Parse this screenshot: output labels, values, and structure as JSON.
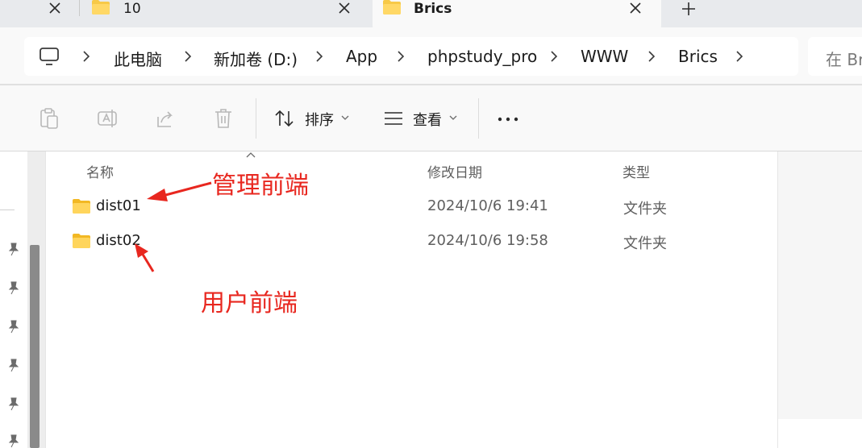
{
  "tabs": [
    {
      "title": "10",
      "icon": "folder-icon",
      "active": false
    },
    {
      "title": "Brics",
      "icon": "folder-icon",
      "active": true
    }
  ],
  "new_tab_icon": "plus-icon",
  "breadcrumb": [
    "此电脑",
    "新加卷 (D:)",
    "App",
    "phpstudy_pro",
    "WWW",
    "Brics"
  ],
  "search": {
    "placeholder": "在 Br"
  },
  "toolbar": {
    "icons": [
      "paste-icon",
      "rename-icon",
      "share-icon",
      "delete-icon"
    ],
    "sort_label": "排序",
    "view_label": "查看",
    "more_icon": "more-icon"
  },
  "columns": {
    "name": "名称",
    "modified": "修改日期",
    "type": "类型"
  },
  "files": [
    {
      "name": "dist01",
      "modified": "2024/10/6 19:41",
      "type": "文件夹"
    },
    {
      "name": "dist02",
      "modified": "2024/10/6 19:58",
      "type": "文件夹"
    }
  ],
  "annotations": [
    "管理前端",
    "用户前端"
  ],
  "colors": {
    "folder": "#f7c948",
    "annotation": "#e8271f",
    "accent": "#ffffff"
  }
}
